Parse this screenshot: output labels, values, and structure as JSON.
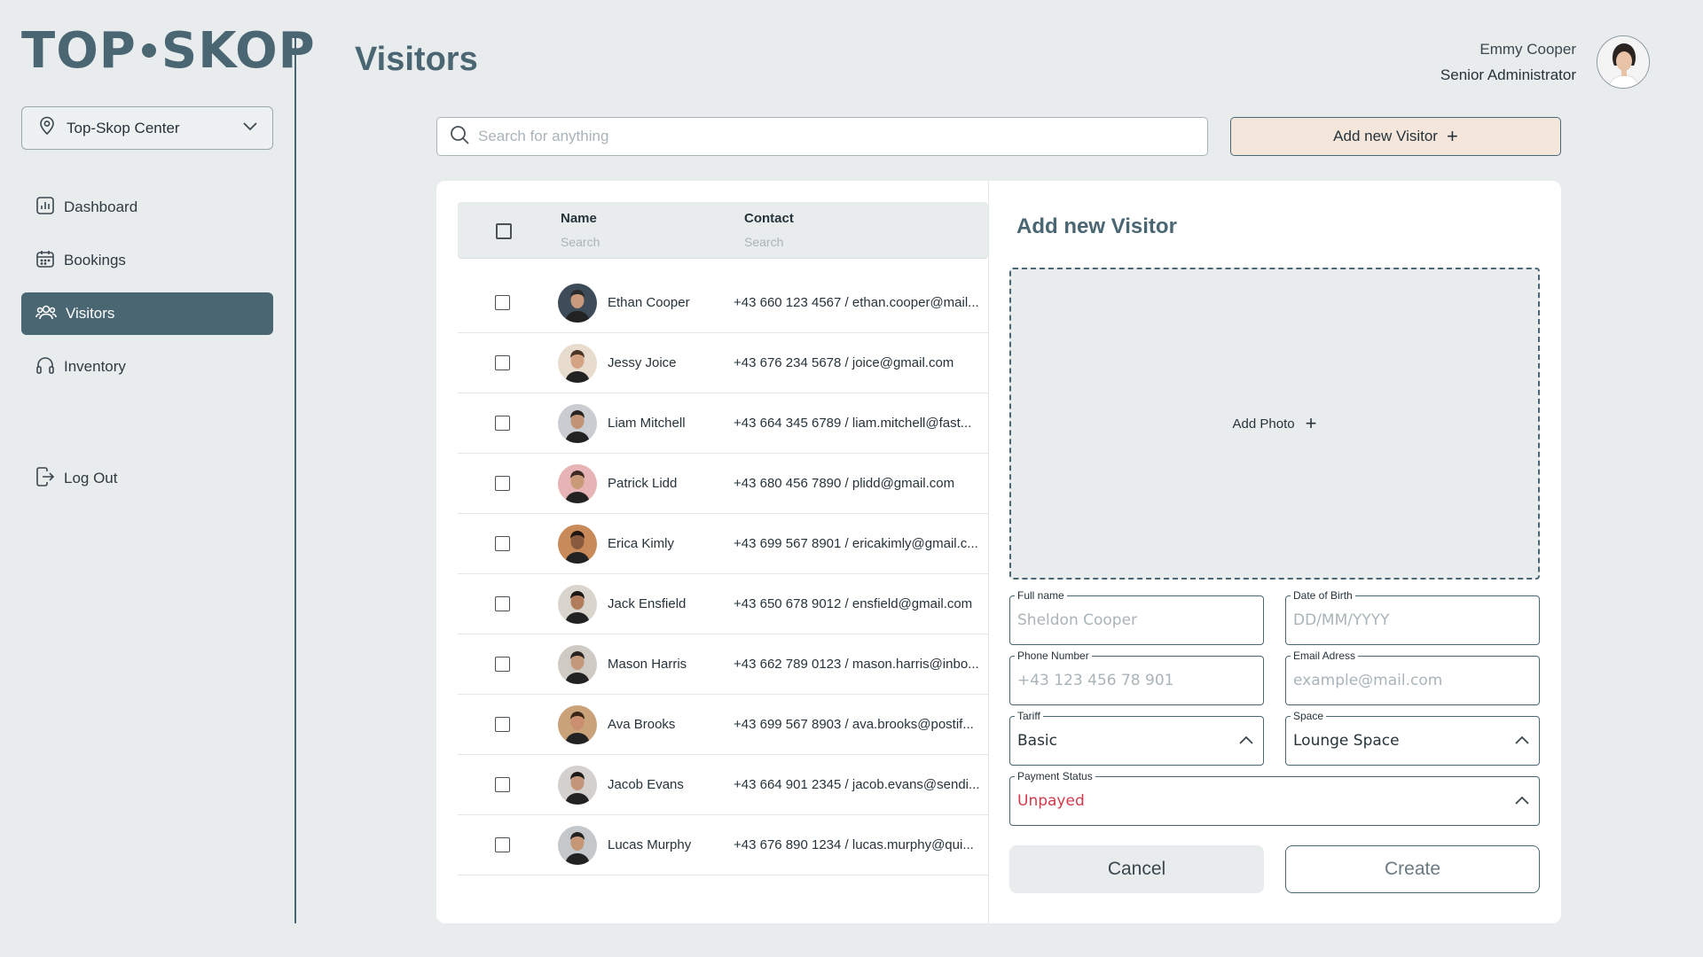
{
  "app": {
    "logo_left": "TOP",
    "logo_right": "SKOP"
  },
  "sidebar": {
    "location": "Top-Skop Center",
    "items": [
      {
        "label": "Dashboard",
        "icon": "chart-icon"
      },
      {
        "label": "Bookings",
        "icon": "calendar-icon"
      },
      {
        "label": "Visitors",
        "icon": "users-icon",
        "active": true
      },
      {
        "label": "Inventory",
        "icon": "headphones-icon"
      }
    ],
    "logout": "Log Out"
  },
  "header": {
    "title": "Visitors",
    "user_name": "Emmy Cooper",
    "user_role": "Senior Administrator"
  },
  "search": {
    "placeholder": "Search for anything"
  },
  "toolbar": {
    "add_label": "Add new Visitor"
  },
  "table": {
    "col_name": "Name",
    "col_name_search": "Search",
    "col_contact": "Contact",
    "col_contact_search": "Search",
    "rows": [
      {
        "name": "Ethan Cooper",
        "contact": "+43 660 123 4567 / ethan.cooper@mail..."
      },
      {
        "name": "Jessy Joice",
        "contact": "+43 676 234 5678 / joice@gmail.com"
      },
      {
        "name": "Liam Mitchell",
        "contact": "+43 664 345 6789 / liam.mitchell@fast..."
      },
      {
        "name": "Patrick Lidd",
        "contact": "+43 680 456 7890 / plidd@gmail.com"
      },
      {
        "name": "Erica Kimly",
        "contact": "+43 699 567 8901 / ericakimly@gmail.c..."
      },
      {
        "name": "Jack Ensfield",
        "contact": "+43 650 678 9012 / ensfield@gmail.com"
      },
      {
        "name": "Mason Harris",
        "contact": "+43 662 789 0123 / mason.harris@inbo..."
      },
      {
        "name": "Ava Brooks",
        "contact": "+43 699 567 8903 / ava.brooks@postif..."
      },
      {
        "name": "Jacob Evans",
        "contact": "+43 664 901 2345 / jacob.evans@sendi..."
      },
      {
        "name": "Lucas Murphy",
        "contact": "+43 676 890 1234 / lucas.murphy@qui..."
      }
    ]
  },
  "form": {
    "title": "Add new Visitor",
    "add_photo": "Add Photo",
    "full_name_label": "Full name",
    "full_name_placeholder": "Sheldon Cooper",
    "dob_label": "Date of Birth",
    "dob_placeholder": "DD/MM/YYYY",
    "phone_label": "Phone Number",
    "phone_placeholder": "+43 123 456 78 901",
    "email_label": "Email Adress",
    "email_placeholder": "example@mail.com",
    "tariff_label": "Tariff",
    "tariff_value": "Basic",
    "space_label": "Space",
    "space_value": "Lounge Space",
    "payment_label": "Payment Status",
    "payment_value": "Unpayed",
    "cancel": "Cancel",
    "create": "Create"
  },
  "colors": {
    "brand": "#4a6673",
    "accent_button": "#f5e6db",
    "background": "#e9eced",
    "unpaid": "#d33a4a"
  }
}
